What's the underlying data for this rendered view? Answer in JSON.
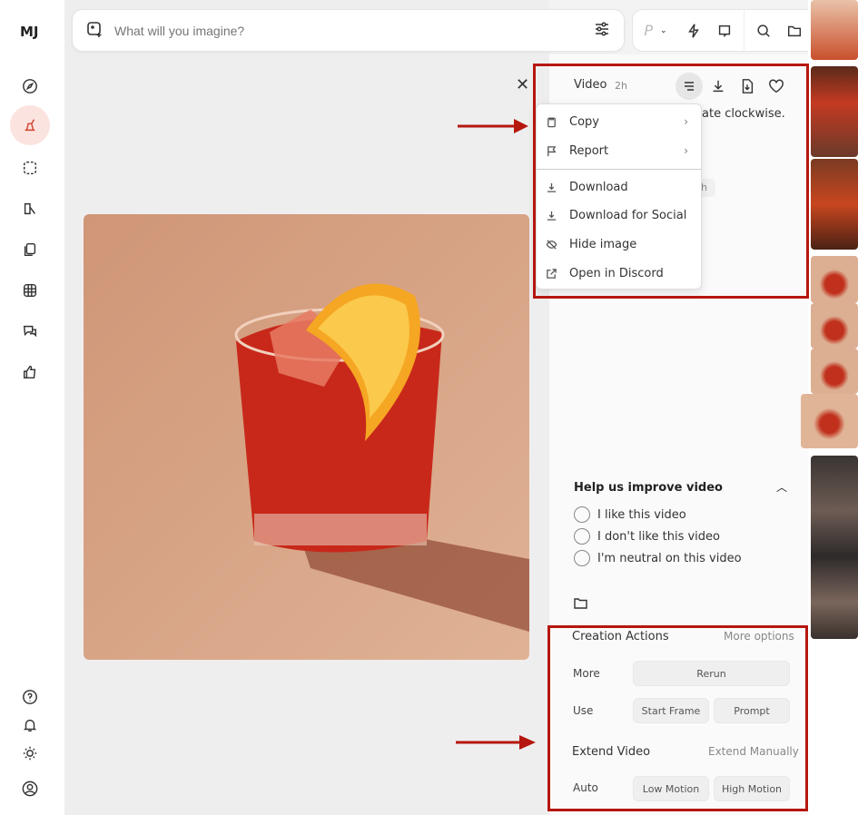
{
  "sidebar": {
    "logo": "MJ",
    "items": [
      "explore-icon",
      "create-icon",
      "edit-icon",
      "personalize-icon",
      "organize-icon",
      "grid-icon",
      "chat-icon",
      "like-icon"
    ],
    "bottom": [
      "help-icon",
      "bell-icon",
      "sun-icon",
      "account-icon"
    ]
  },
  "search": {
    "placeholder": "What will you imagine?",
    "mode_letter": "P"
  },
  "detail": {
    "type": "Video",
    "age": "2h",
    "prompt_fragment": "ate clockwise.",
    "chip_fragment": "h"
  },
  "menu": {
    "items": [
      {
        "label": "Copy",
        "icon": "clipboard-icon",
        "submenu": true
      },
      {
        "label": "Report",
        "icon": "flag-icon",
        "submenu": true
      },
      {
        "label": "Download",
        "icon": "download-icon"
      },
      {
        "label": "Download for Social",
        "icon": "download-icon"
      },
      {
        "label": "Hide image",
        "icon": "eye-off-icon"
      },
      {
        "label": "Open in Discord",
        "icon": "external-link-icon"
      }
    ]
  },
  "feedback": {
    "title": "Help us improve video",
    "options": [
      "I like this video",
      "I don't like this video",
      "I'm neutral on this video"
    ]
  },
  "actions": {
    "title": "Creation Actions",
    "more_options": "More options",
    "rows": [
      {
        "label": "More",
        "buttons": [
          "Rerun"
        ]
      },
      {
        "label": "Use",
        "buttons": [
          "Start Frame",
          "Prompt"
        ]
      }
    ],
    "extend_title": "Extend Video",
    "extend_manual": "Extend Manually",
    "auto": {
      "label": "Auto",
      "buttons": [
        "Low Motion",
        "High Motion"
      ]
    }
  },
  "colors": {
    "annotation": "#b5170f",
    "image_bg": "#d9a585",
    "drink": "#c8281a"
  }
}
